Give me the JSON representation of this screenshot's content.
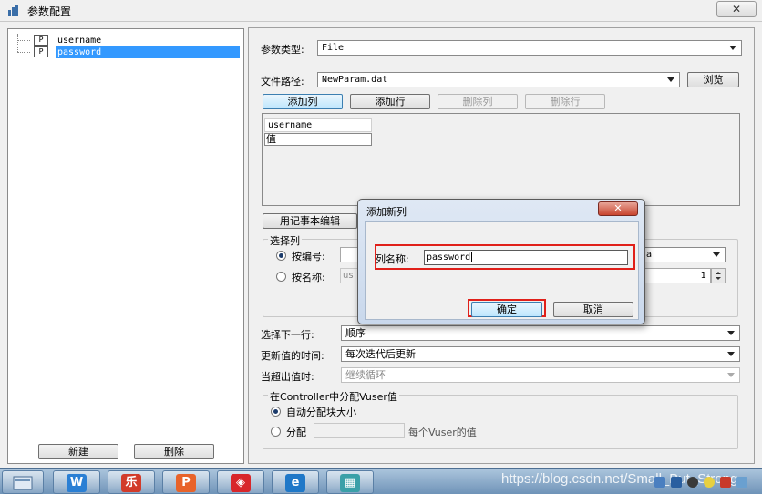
{
  "window": {
    "title": "参数配置",
    "close_label": "✕"
  },
  "tree": {
    "items": [
      {
        "label": "username",
        "icon": "P",
        "selected": false
      },
      {
        "label": "password",
        "icon": "P",
        "selected": true
      }
    ]
  },
  "left_buttons": {
    "new_label": "新建",
    "delete_label": "删除"
  },
  "param_type": {
    "label": "参数类型:",
    "value": "File"
  },
  "file_path": {
    "label": "文件路径:",
    "value": "NewParam.dat",
    "browse_label": "浏览"
  },
  "toolbar": {
    "add_column": "添加列",
    "add_row": "添加行",
    "delete_column": "删除列",
    "delete_row": "删除行"
  },
  "grid": {
    "header": "username",
    "cell": "值"
  },
  "notepad_edit_label": "用记事本编辑",
  "select_column": {
    "group_label": "选择列",
    "by_number_label": "按编号:",
    "by_name_label": "按名称:",
    "by_name_value": "us",
    "delimiter_partial": "a",
    "first_line_value": "1"
  },
  "next_row": {
    "label": "选择下一行:",
    "value": "顺序"
  },
  "update_value": {
    "label": "更新值的时间:",
    "value": "每次迭代后更新"
  },
  "out_of_values": {
    "label": "当超出值时:",
    "value": "继续循环"
  },
  "controller": {
    "group_label": "在Controller中分配Vuser值",
    "auto_label": "自动分配块大小",
    "allocate_label": "分配",
    "per_vuser_label": "每个Vuser的值"
  },
  "dialog": {
    "title": "添加新列",
    "close_label": "✕",
    "field_label": "列名称:",
    "field_value": "password",
    "ok_label": "确定",
    "cancel_label": "取消"
  },
  "taskbar": {
    "watermark": "https://blog.csdn.net/Small_But_Strong",
    "apps": [
      {
        "icon": "w-icon",
        "glyph": "W",
        "color": "#2a7fd4"
      },
      {
        "icon": "music-icon",
        "glyph": "乐",
        "color": "#d23b2a"
      },
      {
        "icon": "p-icon",
        "glyph": "P",
        "color": "#e8632a"
      },
      {
        "icon": "loadrunner-icon",
        "glyph": "◈",
        "color": "#d8262a"
      },
      {
        "icon": "ie-icon",
        "glyph": "e",
        "color": "#1f78c8"
      },
      {
        "icon": "app-icon",
        "glyph": "▦",
        "color": "#3aa0a8"
      }
    ]
  },
  "colors": {
    "selection": "#3399ff",
    "highlight": "#e0201a"
  }
}
